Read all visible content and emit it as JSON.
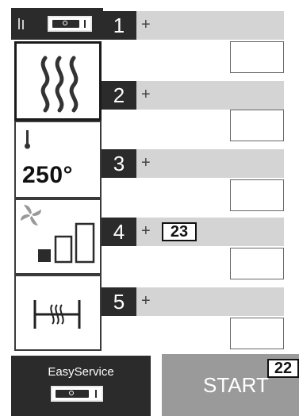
{
  "sidebar": {
    "temperature": "250°"
  },
  "steps": [
    {
      "number": "1",
      "plus": "+",
      "badge": ""
    },
    {
      "number": "2",
      "plus": "+",
      "badge": ""
    },
    {
      "number": "3",
      "plus": "+",
      "badge": ""
    },
    {
      "number": "4",
      "plus": "+",
      "badge": "23"
    },
    {
      "number": "5",
      "plus": "+",
      "badge": ""
    }
  ],
  "easy_service": {
    "label": "EasyService",
    "toggle_state": "off"
  },
  "start": {
    "label": "START",
    "badge": "22"
  },
  "colors": {
    "dark": "#2b2b2b",
    "band": "#d4d4d4",
    "start_bg": "#9a9a9a"
  },
  "icons": [
    "steam-icon",
    "thermometer-icon",
    "fan-icon",
    "fan-speed-bars-icon",
    "humidity-damper-icon",
    "power-toggle-icon"
  ]
}
